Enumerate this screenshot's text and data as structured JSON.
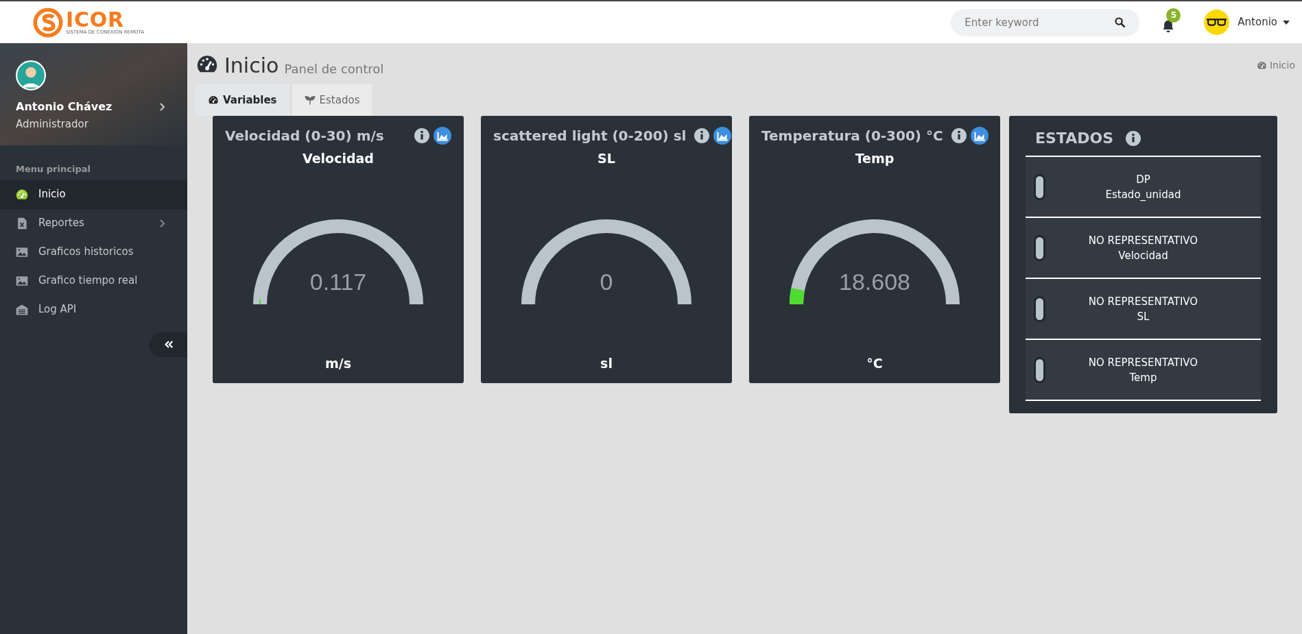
{
  "header": {
    "logo_text": "ICOR",
    "logo_tagline": "SISTEMA DE CONEXIÓN REMOTA",
    "search": {
      "placeholder": "Enter keyword"
    },
    "notifications": "5",
    "user": "Antonio"
  },
  "sidebar": {
    "profile": {
      "name": "Antonio Chávez",
      "role": "Administrador"
    },
    "section": "Menu principal",
    "items": [
      {
        "label": "Inicio",
        "kind": "gauge",
        "selected": true,
        "submenu": false
      },
      {
        "label": "Reportes",
        "kind": "excel",
        "selected": false,
        "submenu": true
      },
      {
        "label": "Graficos historicos",
        "kind": "image",
        "selected": false,
        "submenu": false
      },
      {
        "label": "Grafico tiempo real",
        "kind": "image",
        "selected": false,
        "submenu": false
      },
      {
        "label": "Log API",
        "kind": "warehouse",
        "selected": false,
        "submenu": false
      }
    ]
  },
  "page": {
    "title": "Inicio",
    "subtitle": "Panel de control",
    "breadcrumb": "Inicio"
  },
  "tabs": [
    {
      "label": "Variables",
      "kind": "gauge",
      "selected": true
    },
    {
      "label": "Estados",
      "kind": "sprout",
      "selected": false
    }
  ],
  "gauges": [
    {
      "title": "Velocidad (0-30) m/s",
      "name": "Velocidad",
      "value": "0.117",
      "unit": "m/s",
      "level": 0.004
    },
    {
      "title": "scattered light (0-200) sl",
      "name": "SL",
      "value": "0",
      "unit": "sl"
    },
    {
      "title": "Temperatura (0-300) °C",
      "name": "Temp",
      "value": "18.608",
      "unit": "°C",
      "level": 0.062
    }
  ],
  "states_panel": {
    "title": "ESTADOS",
    "items": [
      {
        "line1": "DP",
        "line2": "Estado_unidad"
      },
      {
        "line1": "NO REPRESENTATIVO",
        "line2": "Velocidad"
      },
      {
        "line1": "NO REPRESENTATIVO",
        "line2": "SL"
      },
      {
        "line1": "NO REPRESENTATIVO",
        "line2": "Temp"
      }
    ]
  }
}
